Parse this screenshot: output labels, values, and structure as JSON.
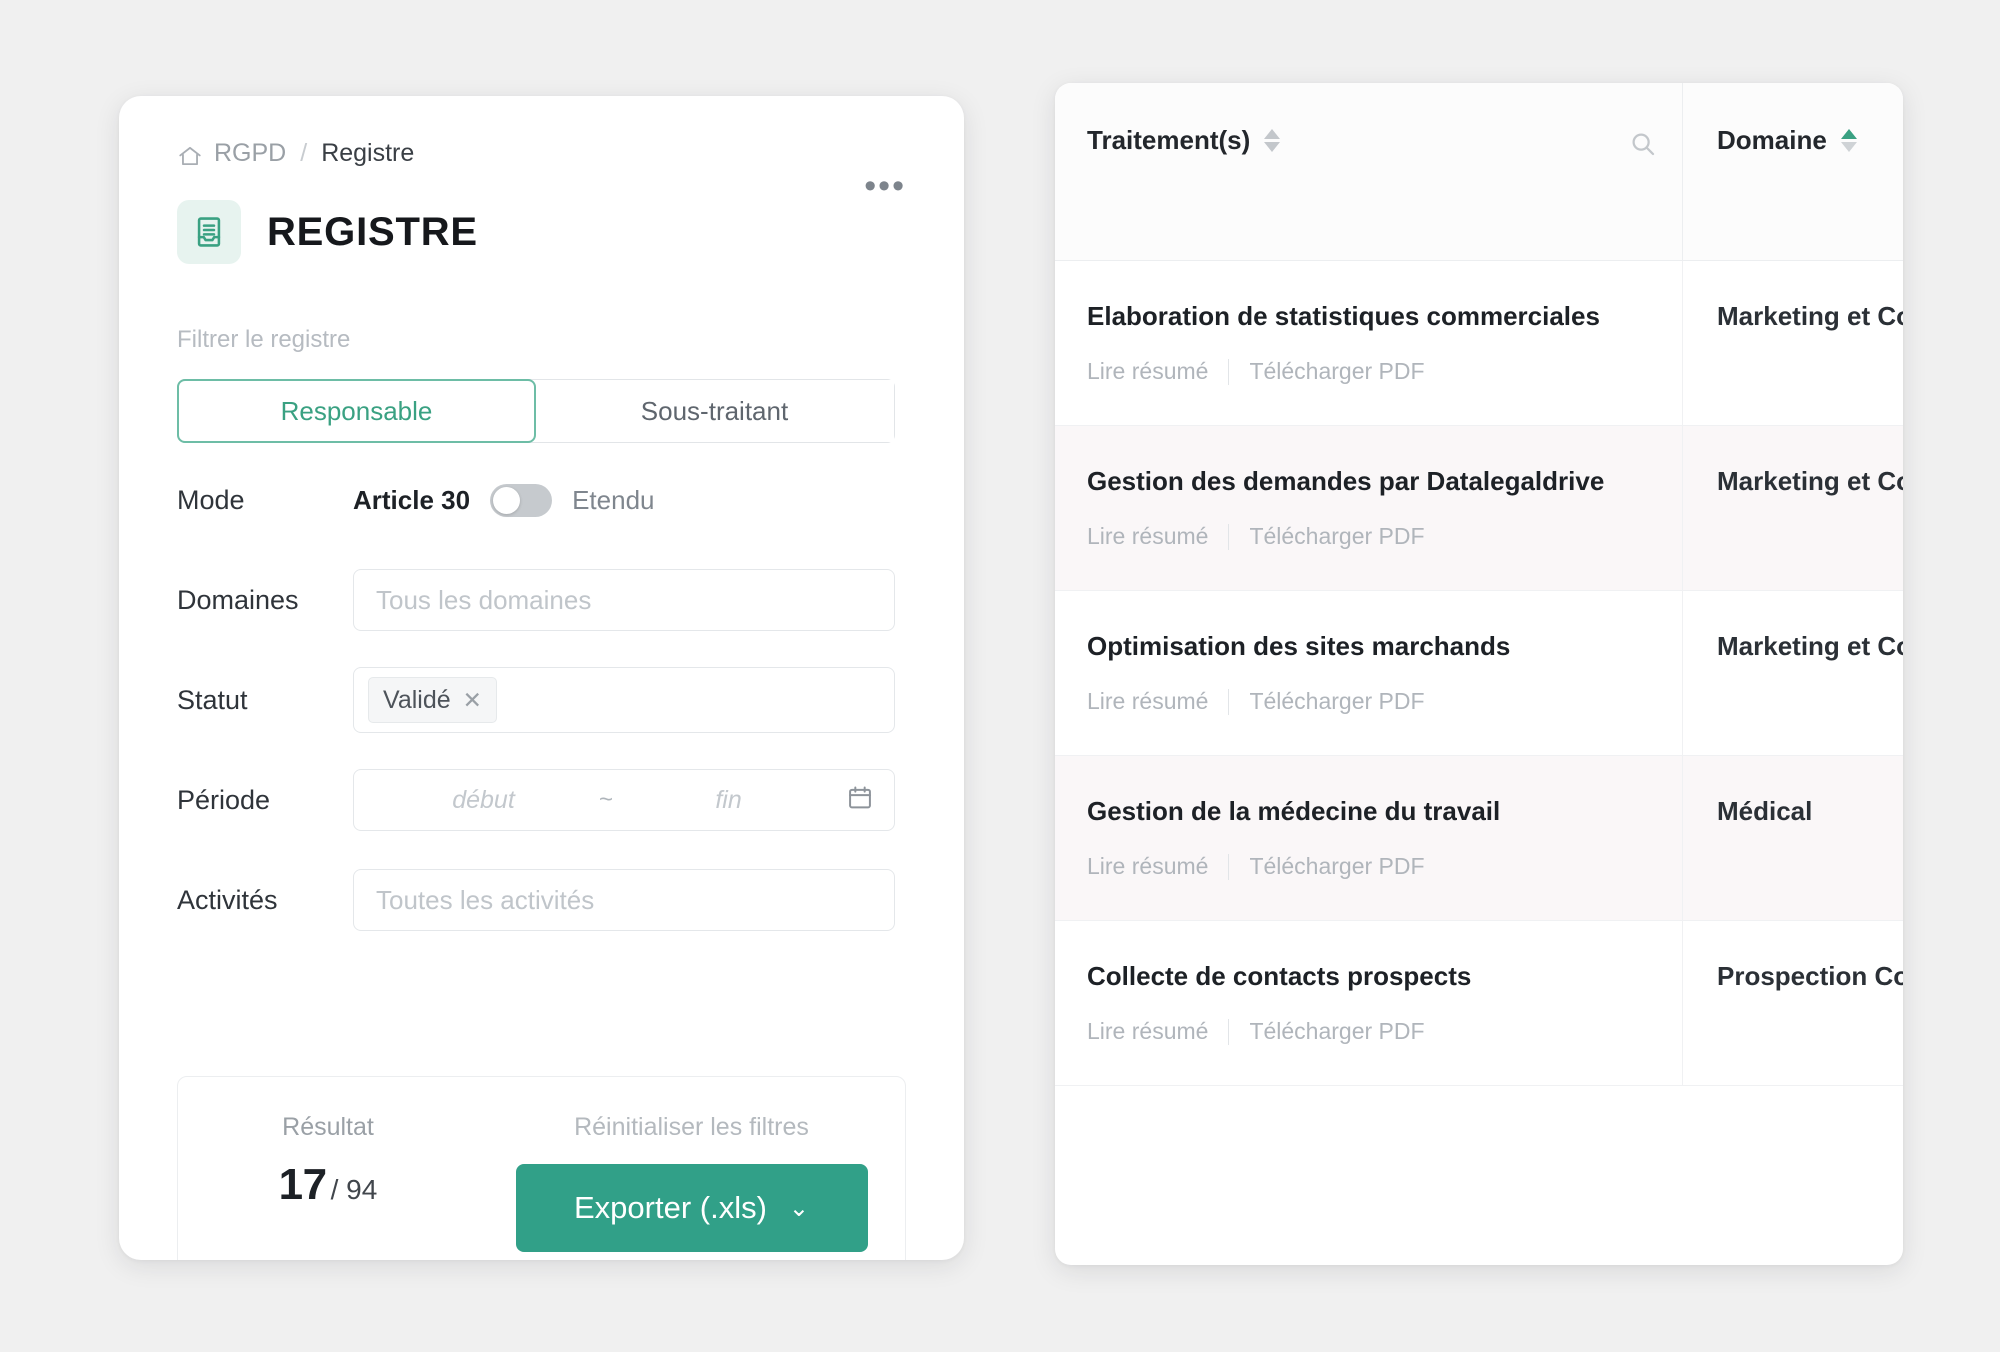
{
  "colors": {
    "accent": "#31a088",
    "accent_light": "#6dbda6",
    "badge_bg": "#e7f3ef",
    "page_bg": "#f0f0f0",
    "row_alt": "#faf7f8"
  },
  "left_panel": {
    "breadcrumb": {
      "home_icon": "home-icon",
      "root": "RGPD",
      "separator": "/",
      "current": "Registre"
    },
    "title_icon": "register-document-icon",
    "title": "REGISTRE",
    "overflow_menu": "•••",
    "filter_caption": "Filtrer le registre",
    "tabs": [
      {
        "label": "Responsable",
        "active": true
      },
      {
        "label": "Sous-traitant",
        "active": false
      }
    ],
    "fields": {
      "mode": {
        "label": "Mode",
        "option_on": "Article 30",
        "option_off": "Etendu",
        "toggle_state": "off"
      },
      "domaines": {
        "label": "Domaines",
        "placeholder": "Tous les domaines",
        "value": ""
      },
      "statut": {
        "label": "Statut",
        "tags": [
          {
            "label": "Validé",
            "remove": "✕"
          }
        ]
      },
      "periode": {
        "label": "Période",
        "start_placeholder": "début",
        "range_separator": "~",
        "end_placeholder": "fin",
        "calendar_icon": "calendar-icon"
      },
      "activites": {
        "label": "Activités",
        "placeholder": "Toutes les activités",
        "value": ""
      }
    },
    "result": {
      "caption": "Résultat",
      "count": "17",
      "total": "/ 94",
      "reset_label": "Réinitialiser les filtres",
      "export_label": "Exporter (.xls)",
      "export_chevron": "⌄"
    }
  },
  "right_panel": {
    "columns": [
      {
        "key": "traitements",
        "label": "Traitement(s)",
        "sort": "none",
        "search_icon": "search-icon"
      },
      {
        "key": "domaine",
        "label": "Domaine",
        "sort": "asc"
      }
    ],
    "row_action_read": "Lire résumé",
    "row_action_pdf": "Télécharger PDF",
    "rows": [
      {
        "traitement": "Elaboration de statistiques commerciales",
        "domaine": "Marketing et Co"
      },
      {
        "traitement": "Gestion des demandes par Datalegaldrive",
        "domaine": "Marketing et Co"
      },
      {
        "traitement": "Optimisation des sites marchands",
        "domaine": "Marketing et Co"
      },
      {
        "traitement": "Gestion de la médecine du travail",
        "domaine": "Médical"
      },
      {
        "traitement": "Collecte de contacts prospects",
        "domaine": "Prospection Co"
      }
    ]
  }
}
